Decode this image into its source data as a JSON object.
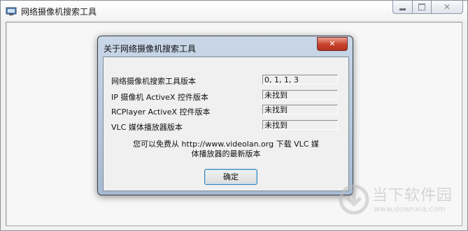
{
  "window": {
    "title": "网络摄像机搜索工具",
    "buttons": {
      "minimize": "—",
      "maximize": "□",
      "close": "✕"
    }
  },
  "dialog": {
    "title": "关于网络摄像机搜索工具",
    "close_glyph": "✕",
    "rows": [
      {
        "label": "网络摄像机搜索工具版本",
        "value": "0, 1, 1, 3"
      },
      {
        "label": "IP 摄像机 ActiveX 控件版本",
        "value": "未找到"
      },
      {
        "label": "RCPlayer ActiveX 控件版本",
        "value": "未找到"
      },
      {
        "label": "VLC 媒体播放器版本",
        "value": "未找到"
      }
    ],
    "info_line1": "您可以免费从 http://www.videolan.org 下载 VLC 媒",
    "info_line2": "体播放器的最新版本",
    "ok_label": "确定"
  },
  "watermark": {
    "main": "当下软件园",
    "sub": "www.downxia.com"
  },
  "icons": {
    "app_icon": "monitor-icon",
    "watermark_logo": "downxia-logo-icon"
  }
}
